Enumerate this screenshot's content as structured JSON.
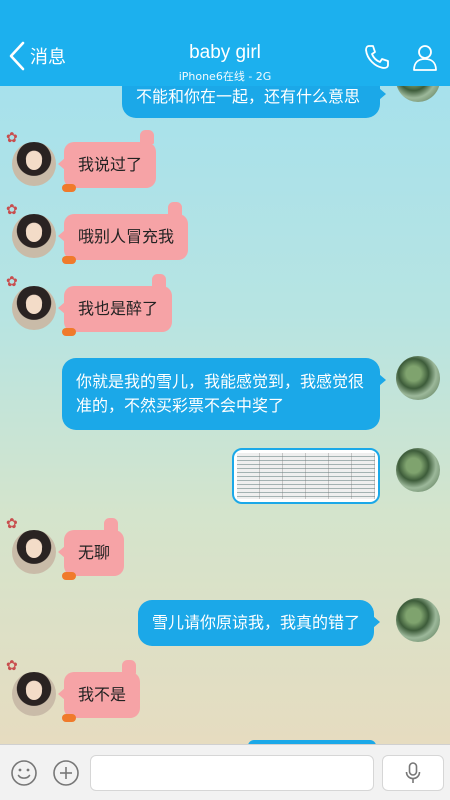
{
  "header": {
    "back_label": "消息",
    "title": "baby girl",
    "subtitle": "iPhone6在线 - 2G"
  },
  "icons": {
    "back": "chevron-left-icon",
    "call": "phone-icon",
    "profile": "person-icon",
    "emoji": "smiley-icon",
    "add": "plus-icon",
    "voice": "microphone-icon"
  },
  "colors": {
    "header_bg": "#1cb0ee",
    "incoming_bubble": "#f6a3a6",
    "outgoing_bubble": "#1ba8e8"
  },
  "messages": [
    {
      "side": "out",
      "text": "不能和你在一起，还有什么意思"
    },
    {
      "side": "in",
      "text": "我说过了"
    },
    {
      "side": "in",
      "text": "哦别人冒充我"
    },
    {
      "side": "in",
      "text": "我也是醉了"
    },
    {
      "side": "out",
      "text": "你就是我的雪儿，我能感觉到，我感觉很准的，不然买彩票不会中奖了"
    },
    {
      "side": "out",
      "type": "image",
      "text": ""
    },
    {
      "side": "in",
      "text": "无聊"
    },
    {
      "side": "out",
      "text": "雪儿请你原谅我，我真的错了"
    },
    {
      "side": "in",
      "text": "我不是"
    }
  ],
  "input": {
    "value": "",
    "placeholder": ""
  }
}
